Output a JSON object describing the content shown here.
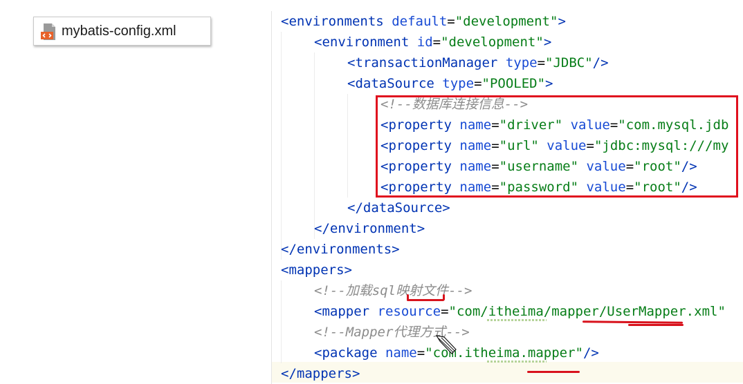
{
  "file": {
    "name": "mybatis-config.xml",
    "icon": "xml-file-icon"
  },
  "code": {
    "l1_tag": "environments",
    "l1_attr": "default",
    "l1_val": "\"development\"",
    "l2_tag": "environment",
    "l2_attr": "id",
    "l2_val": "\"development\"",
    "l3_tag": "transactionManager",
    "l3_attr": "type",
    "l3_val": "\"JDBC\"",
    "l4_tag": "dataSource",
    "l4_attr": "type",
    "l4_val": "\"POOLED\"",
    "l5_comment": "<!--数据库连接信息-->",
    "l6_tag": "property",
    "l6_a1": "name",
    "l6_v1": "\"driver\"",
    "l6_a2": "value",
    "l6_v2": "\"com.mysql.jdb",
    "l7_tag": "property",
    "l7_a1": "name",
    "l7_v1": "\"url\"",
    "l7_a2": "value",
    "l7_v2": "\"jdbc:mysql:///my",
    "l8_tag": "property",
    "l8_a1": "name",
    "l8_v1": "\"username\"",
    "l8_a2": "value",
    "l8_v2": "\"root\"",
    "l9_tag": "property",
    "l9_a1": "name",
    "l9_v1": "\"password\"",
    "l9_a2": "value",
    "l9_v2": "\"root\"",
    "l10_tag": "dataSource",
    "l11_tag": "environment",
    "l12_tag": "environments",
    "l13_tag": "mappers",
    "l14_comment": "<!--加载sql映射文件-->",
    "l15_tag": "mapper",
    "l15_attr": "resource",
    "l15_val": "\"com/itheima/mapper/UserMapper.xml\"",
    "l16_comment": "<!--Mapper代理方式-->",
    "l17_tag": "package",
    "l17_attr": "name",
    "l17_val": "\"com.itheima.mapper\"",
    "l18_tag": "mappers"
  },
  "colors": {
    "tag": "#0033b3",
    "attribute": "#174ad4",
    "string": "#067d17",
    "comment": "#8c8c8c",
    "highlight_box": "#e0101e",
    "annotation_marks": "#d8121c"
  }
}
